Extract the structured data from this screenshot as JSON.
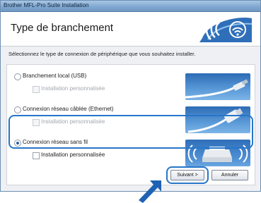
{
  "window": {
    "title": "Brother MFL-Pro Suite Installation"
  },
  "header": {
    "heading": "Type de branchement"
  },
  "instruction": "Sélectionnez le type de connexion de périphérique que vous souhaitez installer.",
  "options": [
    {
      "label": "Branchement local (USB)",
      "selected": false,
      "sub_option": {
        "label": "Installation personnalisée",
        "enabled": false,
        "checked": false
      },
      "image_icon": "usb-cable-icon"
    },
    {
      "label": "Connexion réseau câblée (Ethernet)",
      "selected": false,
      "sub_option": {
        "label": "Installation personnalisée",
        "enabled": false,
        "checked": false
      },
      "image_icon": "ethernet-cable-icon"
    },
    {
      "label": "Connexion réseau sans fil",
      "selected": true,
      "sub_option": {
        "label": "Installation personnalisée",
        "enabled": true,
        "checked": false
      },
      "image_icon": "wireless-printer-icon"
    }
  ],
  "buttons": {
    "next": "Suivant >",
    "cancel": "Annuler"
  },
  "colors": {
    "highlight": "#2676c9",
    "accent": "#2f6fb9"
  }
}
